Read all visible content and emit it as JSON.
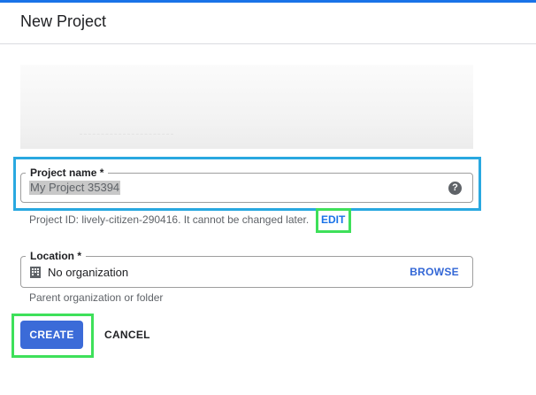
{
  "header": {
    "title": "New Project"
  },
  "project_name": {
    "label": "Project name *",
    "value": "My Project 35394",
    "help_icon": "help-circle-icon"
  },
  "project_id": {
    "text": "Project ID: lively-citizen-290416. It cannot be changed later.",
    "edit_label": "EDIT"
  },
  "location": {
    "label": "Location *",
    "value": "No organization",
    "icon": "building-icon",
    "browse_label": "BROWSE",
    "hint": "Parent organization or folder"
  },
  "actions": {
    "create_label": "CREATE",
    "cancel_label": "CANCEL"
  },
  "colors": {
    "primary": "#3b6bd8",
    "link": "#1a73e8",
    "highlight_blue": "#29a8e0",
    "highlight_green": "#3ee05a"
  }
}
